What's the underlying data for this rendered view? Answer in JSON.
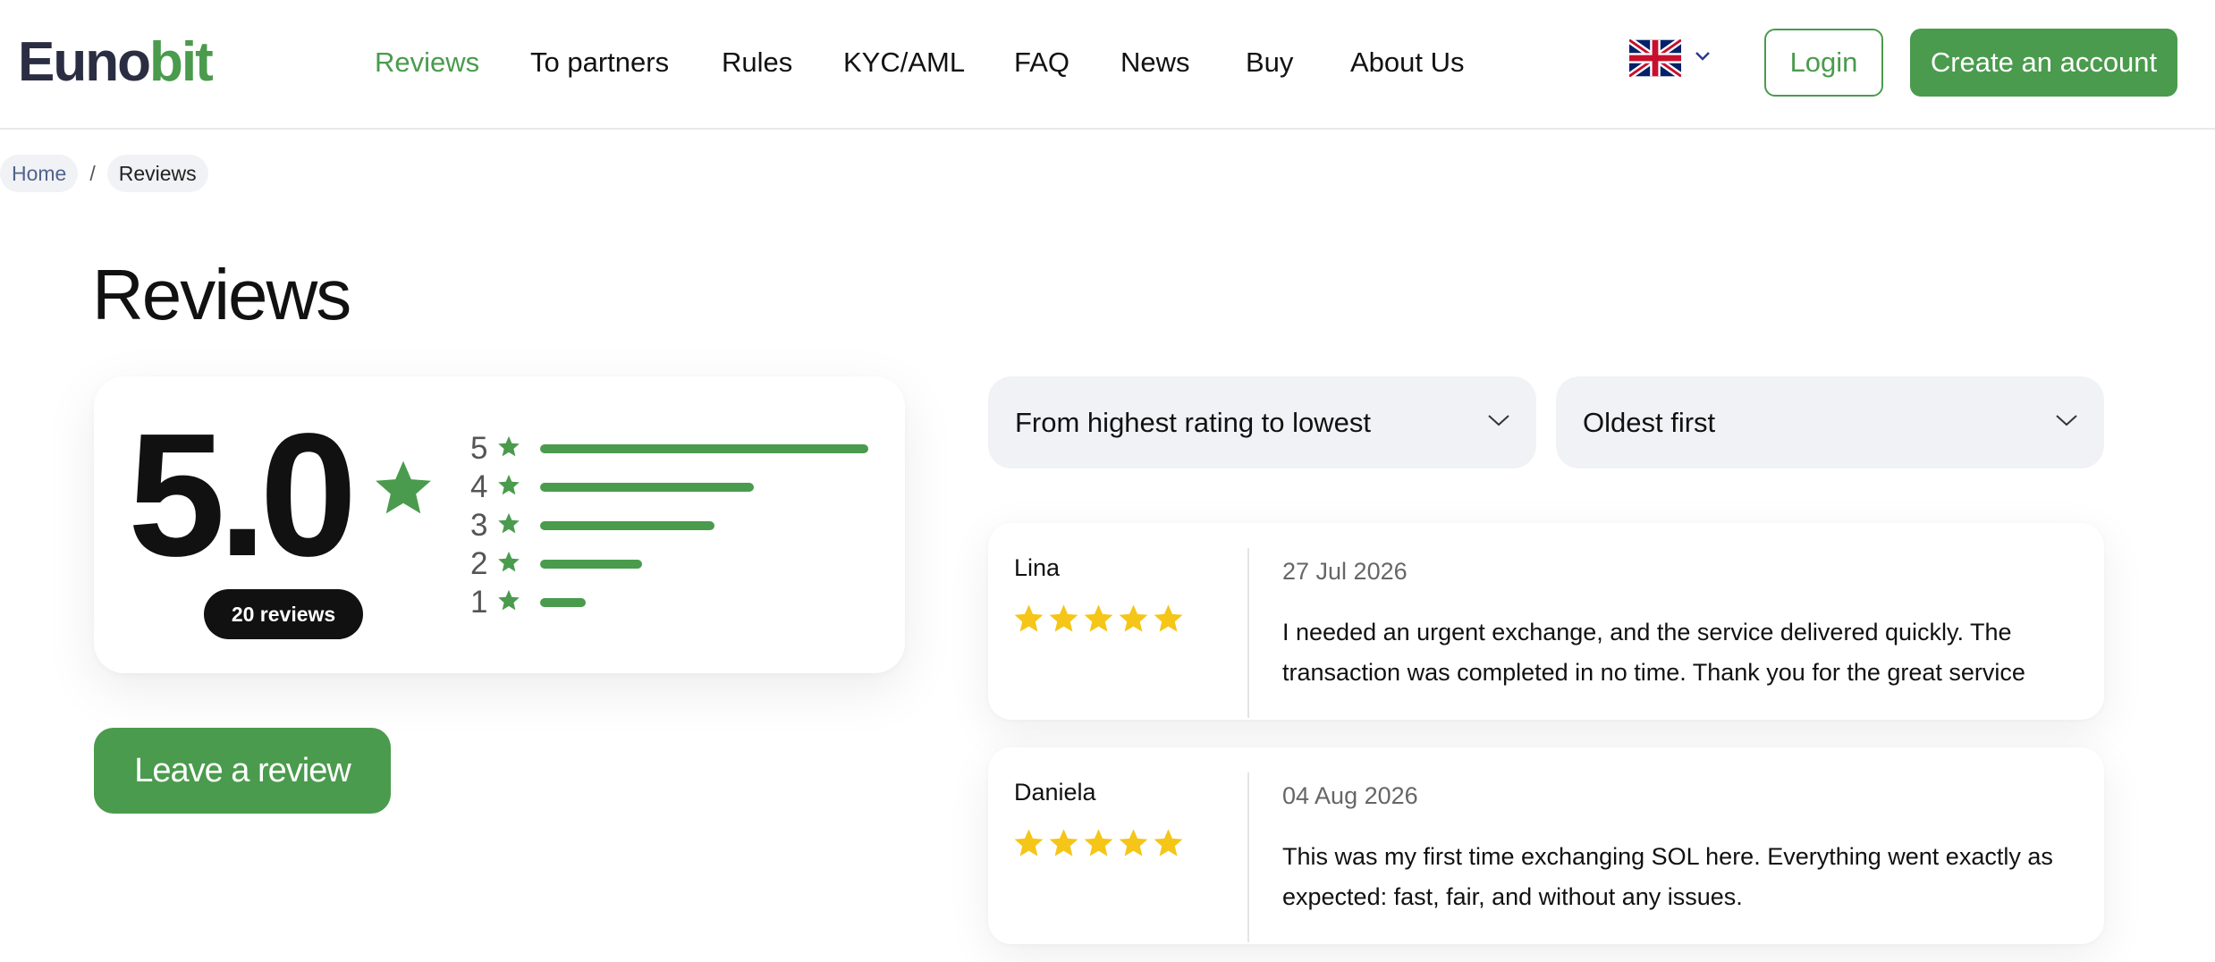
{
  "header": {
    "logo_part1": "Euno",
    "logo_part2": "bit",
    "nav": [
      {
        "label": "Reviews",
        "active": true
      },
      {
        "label": "To partners"
      },
      {
        "label": "Rules"
      },
      {
        "label": "KYC/AML"
      },
      {
        "label": "FAQ"
      },
      {
        "label": "News"
      },
      {
        "label": "Buy"
      },
      {
        "label": "About Us"
      }
    ],
    "language_icon": "uk-flag-icon",
    "login_label": "Login",
    "create_account_label": "Create an account"
  },
  "breadcrumb": {
    "home": "Home",
    "separator": "/",
    "current": "Reviews"
  },
  "page_title": "Reviews",
  "rating": {
    "score": "5.0",
    "reviews_count_label": "20 reviews",
    "distribution": [
      {
        "stars": "5",
        "fraction": 1.0
      },
      {
        "stars": "4",
        "fraction": 0.65
      },
      {
        "stars": "3",
        "fraction": 0.53
      },
      {
        "stars": "2",
        "fraction": 0.31
      },
      {
        "stars": "1",
        "fraction": 0.14
      }
    ]
  },
  "leave_review_label": "Leave a review",
  "filters": {
    "rating_sort": "From highest rating to lowest",
    "date_sort": "Oldest first"
  },
  "reviews": [
    {
      "author": "Lina",
      "rating": 5,
      "date": "27 Jul 2026",
      "text": "I needed an urgent exchange, and the service delivered quickly. The transaction was completed in no time. Thank you for the great service"
    },
    {
      "author": "Daniela",
      "rating": 5,
      "date": "04 Aug 2026",
      "text": "This was my first time exchanging SOL here. Everything went exactly as expected: fast, fair, and without any issues."
    }
  ],
  "colors": {
    "brand_green": "#4a9b4d",
    "brand_dark": "#2b2d42",
    "star_yellow": "#f5c518",
    "surface_gray": "#f1f2f5"
  }
}
